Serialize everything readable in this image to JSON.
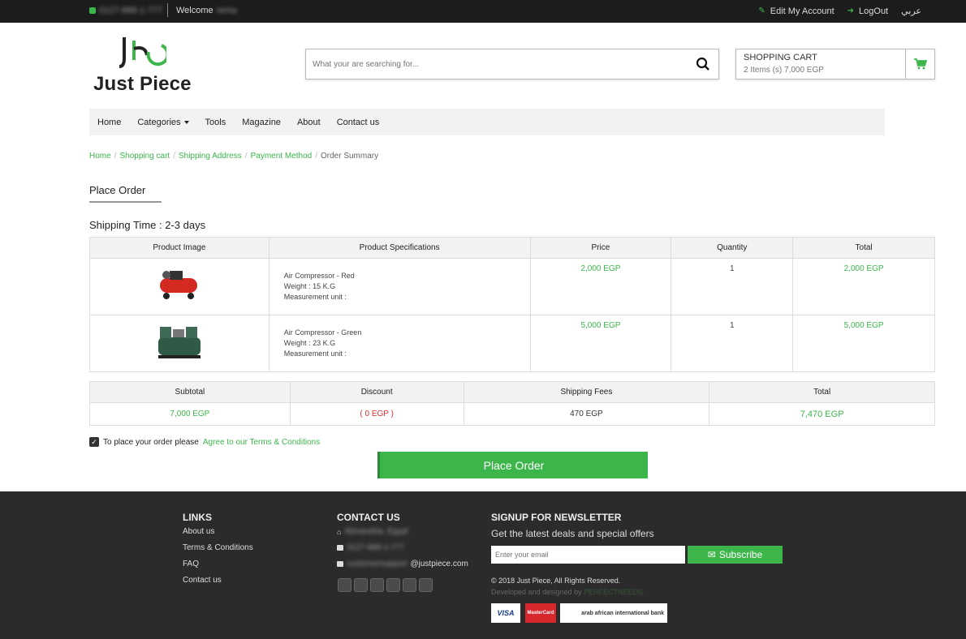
{
  "topbar": {
    "phone": "0127-888-1-777",
    "welcome_label": "Welcome",
    "welcome_name": "rema",
    "edit_account": "Edit My Account",
    "logout": "LogOut",
    "language": "عربي"
  },
  "header": {
    "logo_text": "Just Piece",
    "search_placeholder": "What your are searching for...",
    "cart_title": "SHOPPING CART",
    "cart_summary": "2 Items (s) 7,000 EGP"
  },
  "nav": {
    "items": [
      "Home",
      "Categories",
      "Tools",
      "Magazine",
      "About",
      "Contact us"
    ]
  },
  "breadcrumb": {
    "items": [
      "Home",
      "Shopping cart",
      "Shipping Address",
      "Payment Method"
    ],
    "current": "Order Summary"
  },
  "page_title": "Place Order",
  "shipping_time": "Shipping Time : 2-3 days",
  "products_table": {
    "headers": [
      "Product Image",
      "Product Specifications",
      "Price",
      "Quantity",
      "Total"
    ],
    "rows": [
      {
        "name": "Air Compressor - Red",
        "weight": "Weight : 15 K.G",
        "unit": "Measurement unit :",
        "price": "2,000 EGP",
        "quantity": "1",
        "total": "2,000 EGP",
        "image_color": "#d42a22"
      },
      {
        "name": "Air Compressor - Green",
        "weight": "Weight : 23 K.G",
        "unit": "Measurement unit :",
        "price": "5,000 EGP",
        "quantity": "1",
        "total": "5,000 EGP",
        "image_color": "#2f5a45"
      }
    ]
  },
  "summary_table": {
    "headers": [
      "Subtotal",
      "Discount",
      "Shipping Fees",
      "Total"
    ],
    "values": [
      "7,000 EGP",
      "( 0 EGP )",
      "470 EGP",
      "7,470 EGP"
    ]
  },
  "agree": {
    "text": "To place your order please",
    "link": "Agree to our Terms & Conditions"
  },
  "place_order_button": "Place Order",
  "footer": {
    "links_title": "LINKS",
    "links": [
      "About us",
      "Terms & Conditions",
      "FAQ",
      "Contact us"
    ],
    "contact_title": "CONTACT US",
    "address": "Alexandria, Egypt",
    "phone": "0127-888-1-777",
    "email_user": "customersupport",
    "email_domain": "@justpiece.com",
    "newsletter_title": "SIGNUP FOR NEWSLETTER",
    "newsletter_sub": "Get the latest deals and special offers",
    "email_placeholder": "Enter your email",
    "subscribe": "Subscribe",
    "copyright": "© 2018 Just Piece, All Rights Reserved.",
    "developed_by": "Developed and designed by",
    "developer": "PERFECTNEEDS",
    "payment_visa": "VISA",
    "payment_mastercard": "MasterCard",
    "payment_bank": "arab african international bank"
  },
  "colors": {
    "accent": "#3cb64b",
    "danger": "#e52d2d",
    "topbar": "#1c1c1c",
    "footer": "#2b2b2b"
  }
}
